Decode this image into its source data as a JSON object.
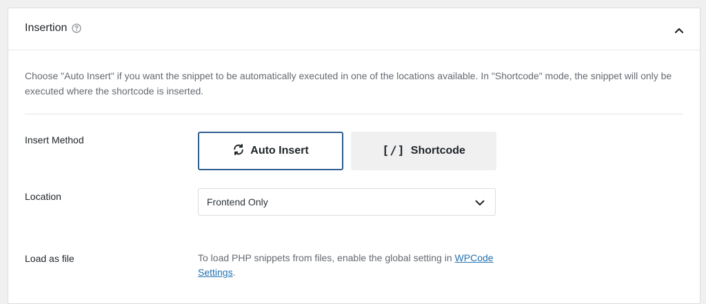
{
  "panel": {
    "title": "Insertion",
    "description": "Choose \"Auto Insert\" if you want the snippet to be automatically executed in one of the locations available. In \"Shortcode\" mode, the snippet will only be executed where the shortcode is inserted."
  },
  "insert_method": {
    "label": "Insert Method",
    "options": [
      {
        "label": "Auto Insert",
        "icon": "refresh-icon",
        "selected": true
      },
      {
        "label": "Shortcode",
        "icon": "shortcode-icon",
        "glyph": "[/]",
        "selected": false
      }
    ]
  },
  "location": {
    "label": "Location",
    "value": "Frontend Only"
  },
  "load_as_file": {
    "label": "Load as file",
    "text_before": "To load PHP snippets from files, enable the global setting in ",
    "link_text": "WPCode Settings",
    "text_after": "."
  },
  "colors": {
    "accent": "#2c5a8f",
    "link": "#2271b1",
    "muted_text": "#646970",
    "background": "#f0f0f1"
  }
}
